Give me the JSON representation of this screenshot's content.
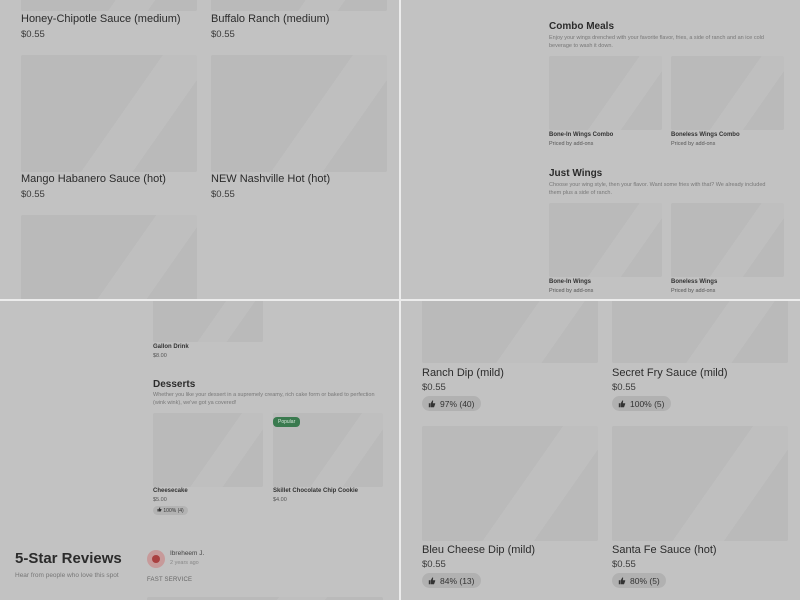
{
  "q1": {
    "items": [
      {
        "name": "Honey-Chipotle Sauce (medium)",
        "price": "$0.55"
      },
      {
        "name": "Buffalo Ranch (medium)",
        "price": "$0.55"
      },
      {
        "name": "Mango Habanero Sauce (hot)",
        "price": "$0.55"
      },
      {
        "name": "NEW Nashville Hot (hot)",
        "price": "$0.55"
      }
    ]
  },
  "q2": {
    "combo": {
      "title": "Combo Meals",
      "desc": "Enjoy your wings drenched with your favorite flavor, fries, a side of ranch and an ice cold beverage to wash it down.",
      "items": [
        {
          "name": "Bone-In Wings Combo",
          "price": "Priced by add-ons"
        },
        {
          "name": "Boneless Wings Combo",
          "price": "Priced by add-ons"
        }
      ]
    },
    "wings": {
      "title": "Just Wings",
      "desc": "Choose your wing style, then your flavor. Want some fries with that? We already included them plus a side of ranch.",
      "items": [
        {
          "name": "Bone-In Wings",
          "price": "Priced by add-ons"
        },
        {
          "name": "Boneless Wings",
          "price": "Priced by add-ons"
        }
      ]
    }
  },
  "q3": {
    "gallon": {
      "name": "Gallon Drink",
      "price": "$8.00"
    },
    "desserts": {
      "title": "Desserts",
      "desc": "Whether you like your dessert in a supremely creamy, rich cake form or baked to perfection (wink wink), we've got ya covered!",
      "popular_label": "Popular",
      "items": [
        {
          "name": "Cheesecake",
          "price": "$5.00",
          "rating": "100% (4)"
        },
        {
          "name": "Skillet Chocolate Chip Cookie",
          "price": "$4.00"
        }
      ]
    },
    "reviews": {
      "title": "5-Star Reviews",
      "subtitle": "Hear from people who love this spot",
      "reviewer": "Ibreheem J.",
      "date": "2 years ago",
      "tag": "FAST SERVICE"
    }
  },
  "q4": {
    "items": [
      {
        "name": "Ranch Dip (mild)",
        "price": "$0.55",
        "rating": "97% (40)"
      },
      {
        "name": "Secret Fry Sauce (mild)",
        "price": "$0.55",
        "rating": "100% (5)"
      },
      {
        "name": "Bleu Cheese Dip (mild)",
        "price": "$0.55",
        "rating": "84% (13)"
      },
      {
        "name": "Santa Fe Sauce (hot)",
        "price": "$0.55",
        "rating": "80% (5)"
      }
    ]
  }
}
